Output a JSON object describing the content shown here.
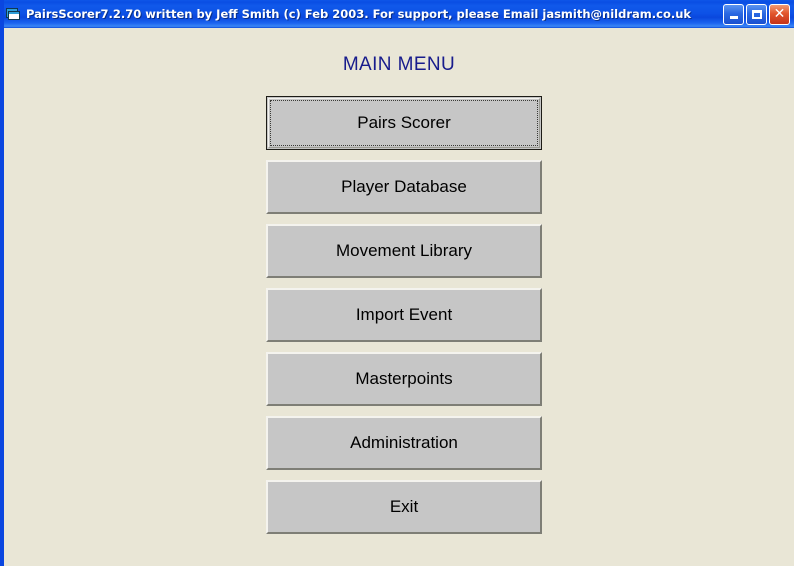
{
  "window": {
    "title": "PairsScorer7.2.70 written by Jeff Smith (c) Feb 2003.  For support, please Email jasmith@nildram.co.uk",
    "icon": "form-window-icon",
    "accent_color": "#0a46e0",
    "client_background": "#e9e6d6",
    "caption_buttons": [
      {
        "name": "minimize",
        "glyph": "_",
        "color": "#2a68e2"
      },
      {
        "name": "maximize",
        "glyph": "□",
        "color": "#2a68e2"
      },
      {
        "name": "close",
        "glyph": "✕",
        "color": "#e2562c"
      }
    ]
  },
  "main": {
    "heading": "MAIN MENU",
    "heading_color": "#181c8c",
    "button_face_color": "#c6c6c6",
    "buttons": [
      {
        "label": "Pairs Scorer",
        "name": "pairs-scorer",
        "focused": true
      },
      {
        "label": "Player Database",
        "name": "player-database",
        "focused": false
      },
      {
        "label": "Movement Library",
        "name": "movement-library",
        "focused": false
      },
      {
        "label": "Import Event",
        "name": "import-event",
        "focused": false
      },
      {
        "label": "Masterpoints",
        "name": "masterpoints",
        "focused": false
      },
      {
        "label": "Administration",
        "name": "administration",
        "focused": false
      },
      {
        "label": "Exit",
        "name": "exit",
        "focused": false
      }
    ]
  }
}
